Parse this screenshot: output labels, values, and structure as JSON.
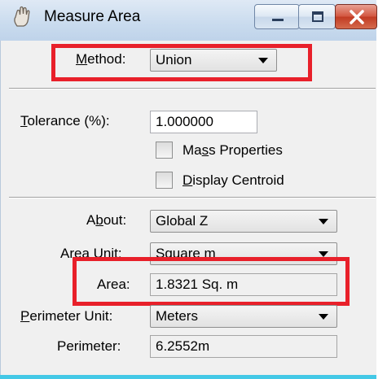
{
  "window": {
    "title": "Measure Area",
    "icon": "measure-area-hand-icon"
  },
  "method": {
    "label": "Method:",
    "value": "Union"
  },
  "tolerance": {
    "label": "Tolerance (%):",
    "value": "1.000000"
  },
  "mass_properties": {
    "label": "Mass Properties",
    "checked": false
  },
  "display_centroid": {
    "label": "Display Centroid",
    "checked": false
  },
  "about": {
    "label": "About:",
    "value": "Global Z"
  },
  "area_unit": {
    "label": "Area Unit:",
    "value": "Square m"
  },
  "area": {
    "label": "Area:",
    "value": "1.8321 Sq. m"
  },
  "perimeter_unit": {
    "label": "Perimeter Unit:",
    "value": "Meters"
  },
  "perimeter": {
    "label": "Perimeter:",
    "value": "6.2552m"
  },
  "colors": {
    "highlight": "#e8202a",
    "close_button": "#c13a22",
    "titlebar": "#c9dbee",
    "bottom_accent": "#43c8e6"
  }
}
